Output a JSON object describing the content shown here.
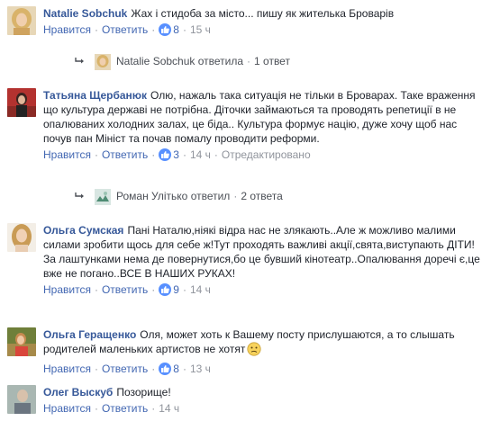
{
  "ui": {
    "like": "Нравится",
    "reply": "Ответить",
    "sep": "·",
    "edited": "Отредактировано"
  },
  "comments": [
    {
      "author": "Natalie Sobchuk",
      "text": "Жах і стидоба за місто... пишу як жителька Броварів",
      "likes": "8",
      "time": "15 ч",
      "replies": {
        "name": "Natalie Sobchuk",
        "verb": "ответила",
        "count": "1 ответ"
      }
    },
    {
      "author": "Татьяна Щербанюк",
      "text": "Олю, нажаль така ситуація не тільки в Броварах. Таке враження що культура державі не потрібна. Діточки займаються та проводять репетиції в не опалюваних холодних залах, це біда.. Культура формує націю, дуже хочу щоб нас почув пан Мініст та почав помалу проводити реформи.",
      "likes": "3",
      "time": "14 ч",
      "replies": {
        "name": "Роман Улітько",
        "verb": "ответил",
        "count": "2 ответа"
      }
    },
    {
      "author": "Ольга Сумская",
      "text": "Пані Наталю,ніякі відра нас не злякають..Але ж можливо малими силами зробити щось для себе ж!Тут проходять важливі акції,свята,виступають ДІТИ!За лаштунками нема де повернутися,бо це бувший кінотеатр..Опалювання доречі є,це вже не погано..ВСЕ В НАШИХ РУКАХ!",
      "likes": "9",
      "time": "14 ч"
    },
    {
      "author": "Ольга Геращенко",
      "text": "Оля, может хоть к Вашему посту прислушаются, а то слышать родителей маленьких артистов не хотят",
      "emoji": "confused-face-icon",
      "likes": "8",
      "time": "13 ч"
    },
    {
      "author": "Олег Выскуб",
      "text": "Позорище!",
      "time": "14 ч"
    }
  ]
}
